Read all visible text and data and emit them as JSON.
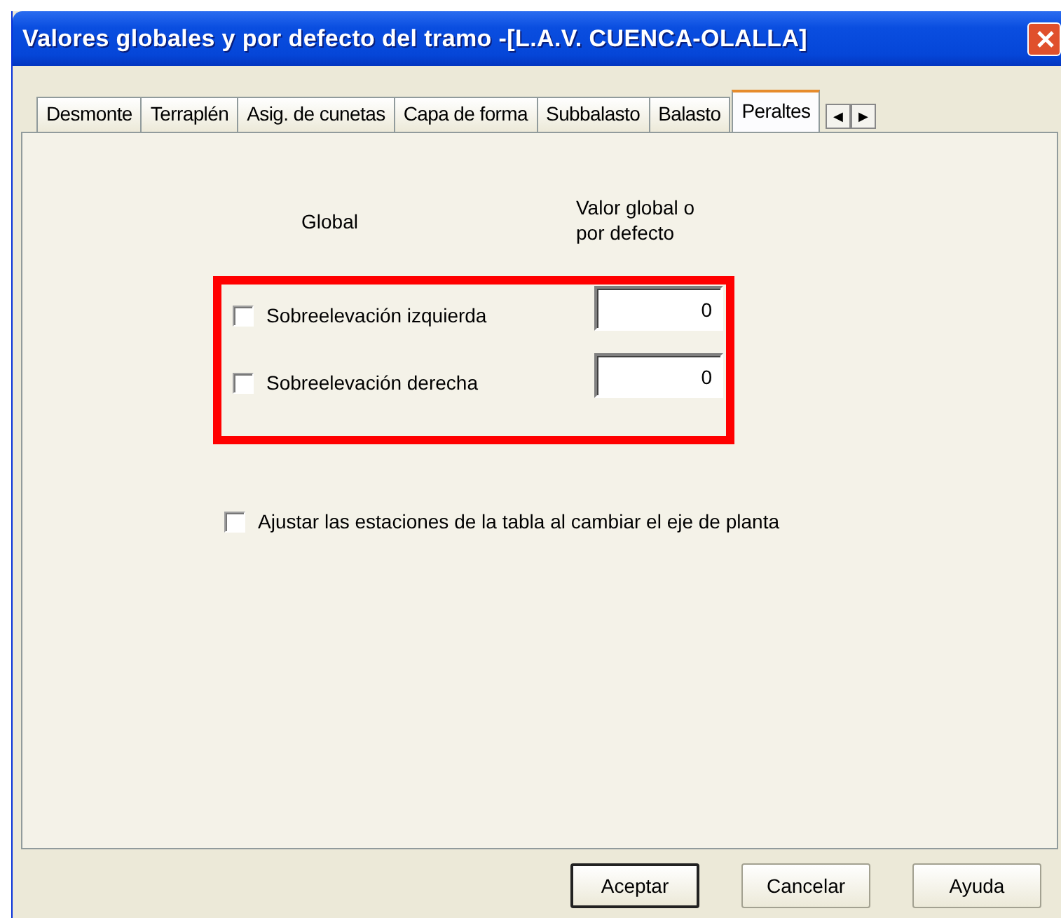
{
  "window": {
    "title": "Valores globales y por defecto del tramo -[L.A.V. CUENCA-OLALLA]"
  },
  "tabs": [
    {
      "label": "Desmonte",
      "selected": false
    },
    {
      "label": "Terraplén",
      "selected": false
    },
    {
      "label": "Asig. de cunetas",
      "selected": false
    },
    {
      "label": "Capa de forma",
      "selected": false
    },
    {
      "label": "Subbalasto",
      "selected": false
    },
    {
      "label": "Balasto",
      "selected": false
    },
    {
      "label": "Peraltes",
      "selected": true
    }
  ],
  "tab_scroll": [
    "◀",
    "▶"
  ],
  "headers": {
    "global": "Global",
    "value": "Valor global o por defecto"
  },
  "rows": [
    {
      "label": "Sobreelevación izquierda",
      "checked": false,
      "value": "0"
    },
    {
      "label": "Sobreelevación derecha",
      "checked": false,
      "value": "0"
    }
  ],
  "adjust": {
    "label": "Ajustar las estaciones de la tabla al cambiar el eje de planta",
    "checked": false
  },
  "buttons": [
    {
      "label": "Aceptar",
      "default": true
    },
    {
      "label": "Cancelar",
      "default": false
    },
    {
      "label": "Ayuda",
      "default": false
    }
  ]
}
